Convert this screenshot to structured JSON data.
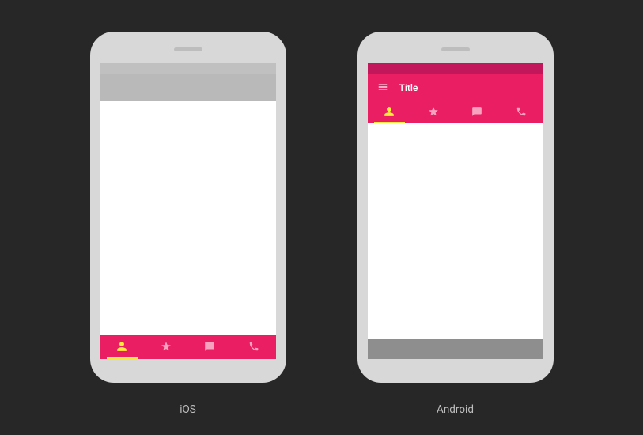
{
  "colors": {
    "background": "#272727",
    "device_body": "#d8d8d8",
    "accent": "#e91e63",
    "accent_dark": "#c2185b",
    "active_indicator": "#ffeb3b",
    "inactive_icon": "#f7a3c0",
    "grey_bar_light": "#c0c0c0",
    "grey_bar_mid": "#b9b9b9",
    "grey_sysnav": "#8e8e8e",
    "caption_text": "#bdbdbd"
  },
  "devices": [
    {
      "id": "ios",
      "caption": "iOS",
      "tabs_position": "bottom",
      "appbar_visible": false,
      "grey_appbar": true,
      "tabs": [
        {
          "icon": "person-icon",
          "active": true
        },
        {
          "icon": "star-icon",
          "active": false
        },
        {
          "icon": "chat-icon",
          "active": false
        },
        {
          "icon": "phone-icon",
          "active": false
        }
      ]
    },
    {
      "id": "android",
      "caption": "Android",
      "tabs_position": "top",
      "appbar_visible": true,
      "appbar_title": "Title",
      "grey_appbar": false,
      "tabs": [
        {
          "icon": "person-icon",
          "active": true
        },
        {
          "icon": "star-icon",
          "active": false
        },
        {
          "icon": "chat-icon",
          "active": false
        },
        {
          "icon": "phone-icon",
          "active": false
        }
      ]
    }
  ]
}
